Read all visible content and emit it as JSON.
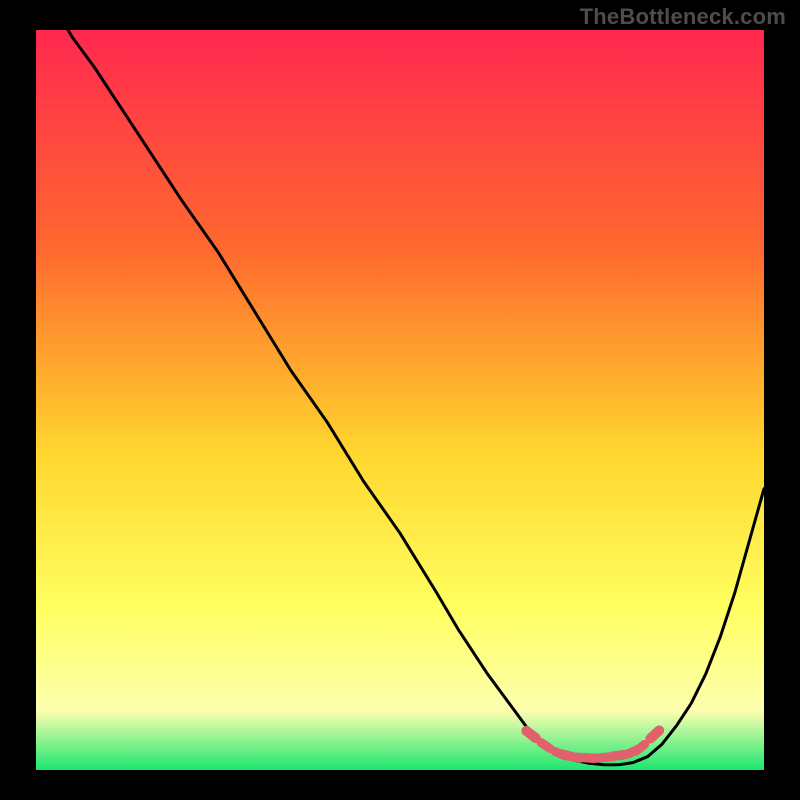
{
  "watermark": "TheBottleneck.com",
  "colors": {
    "background": "#000000",
    "gradient_top": "#ff2850",
    "gradient_mid1": "#ff6a2e",
    "gradient_mid2": "#ffd62e",
    "gradient_mid3": "#ffff60",
    "gradient_mid4": "#fdffb0",
    "gradient_bottom": "#1de56f",
    "curve": "#000000",
    "dash": "#e0616b"
  },
  "chart_data": {
    "type": "line",
    "title": "",
    "xlabel": "",
    "ylabel": "",
    "xlim": [
      0,
      100
    ],
    "ylim": [
      0,
      100
    ],
    "series": [
      {
        "name": "bottleneck-curve",
        "x": [
          0,
          2,
          5,
          8,
          12,
          16,
          20,
          25,
          30,
          35,
          40,
          45,
          50,
          55,
          58,
          62,
          65,
          68,
          70,
          72,
          74,
          76,
          78,
          80,
          82,
          84,
          86,
          88,
          90,
          92,
          94,
          96,
          98,
          100
        ],
        "y": [
          108,
          104,
          99,
          95,
          89,
          83,
          77,
          70,
          62,
          54,
          47,
          39,
          32,
          24,
          19,
          13,
          9,
          5,
          3,
          2,
          1.3,
          0.9,
          0.7,
          0.7,
          1,
          1.8,
          3.5,
          6,
          9,
          13,
          18,
          24,
          31,
          38
        ]
      }
    ],
    "flat_region": {
      "x": [
        68,
        70,
        72,
        73,
        74,
        75,
        76,
        77,
        78,
        79,
        80,
        81,
        82,
        83,
        85
      ],
      "y": [
        4.8,
        3.3,
        2.2,
        2.0,
        1.7,
        1.7,
        1.6,
        1.6,
        1.7,
        1.8,
        2.0,
        2.1,
        2.5,
        3.0,
        4.8
      ]
    }
  }
}
